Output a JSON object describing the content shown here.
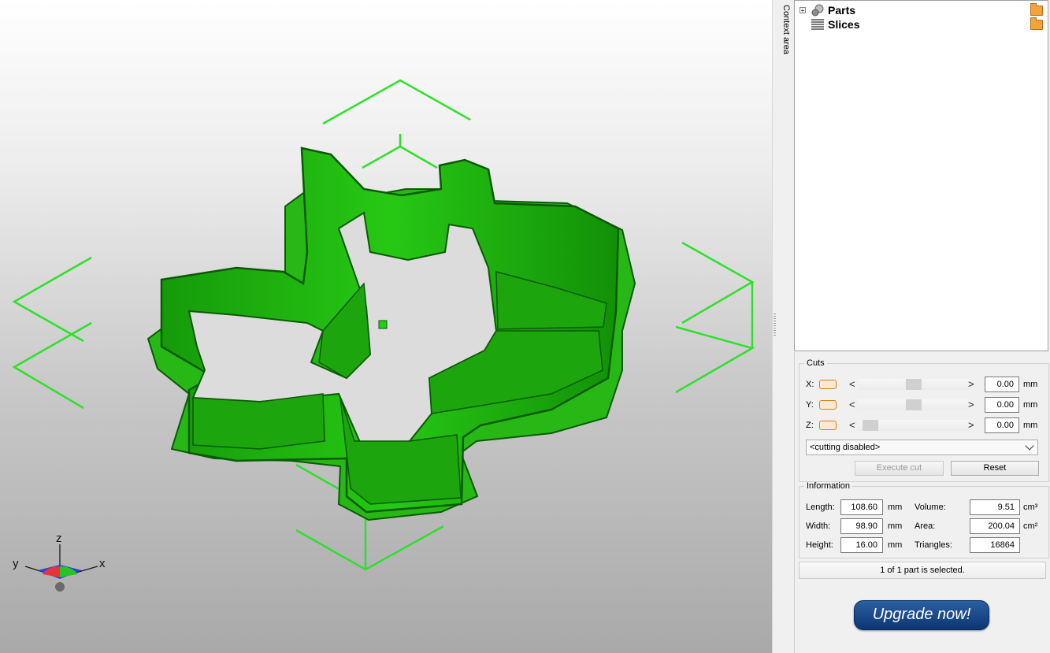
{
  "sidebar": {
    "context_label": "Context area"
  },
  "tree": {
    "items": [
      {
        "label": "Parts",
        "expander": "+"
      },
      {
        "label": "Slices"
      }
    ]
  },
  "cuts": {
    "title": "Cuts",
    "axes": [
      {
        "axis": "X:",
        "value": "0.00",
        "unit": "mm",
        "slider_position": 0.5
      },
      {
        "axis": "Y:",
        "value": "0.00",
        "unit": "mm",
        "slider_position": 0.5
      },
      {
        "axis": "Z:",
        "value": "0.00",
        "unit": "mm",
        "slider_position": 0.05
      }
    ],
    "arrow_left": "<",
    "arrow_right": ">",
    "mode": "<cutting disabled>",
    "execute_label": "Execute cut",
    "reset_label": "Reset"
  },
  "info": {
    "title": "Information",
    "length_label": "Length:",
    "length_value": "108.60",
    "length_unit": "mm",
    "width_label": "Width:",
    "width_value": "98.90",
    "width_unit": "mm",
    "height_label": "Height:",
    "height_value": "16.00",
    "height_unit": "mm",
    "volume_label": "Volume:",
    "volume_value": "9.51",
    "volume_unit": "cm³",
    "area_label": "Area:",
    "area_value": "200.04",
    "area_unit": "cm²",
    "triangles_label": "Triangles:",
    "triangles_value": "16864"
  },
  "status": "1 of 1 part is selected.",
  "upgrade_label": "Upgrade now!",
  "axes_gizmo": {
    "z": "z",
    "y": "y",
    "x": "x"
  },
  "colors": {
    "model": "#1fb70f",
    "model_dark": "#0b6a06",
    "bounding_box": "#2ee02a",
    "accent_button": "#0c3673"
  }
}
